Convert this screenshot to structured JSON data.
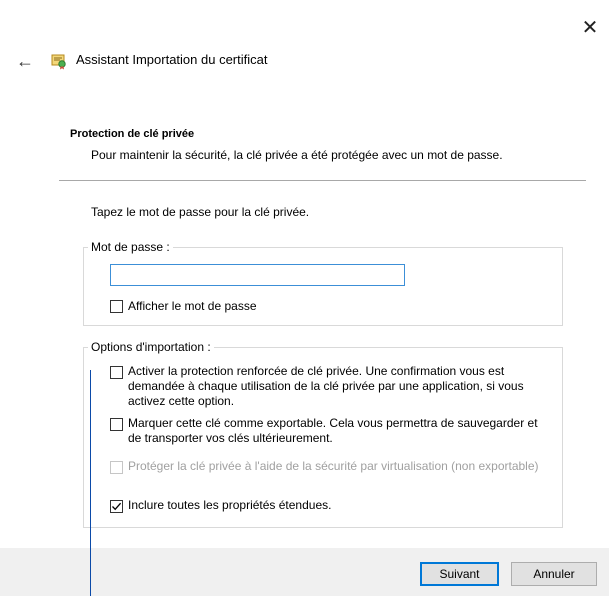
{
  "window": {
    "title": "Assistant Importation du certificat",
    "close_glyph": "✕",
    "back_glyph": "←",
    "icon": "certificate-icon"
  },
  "section": {
    "title": "Protection de clé privée",
    "subtitle": "Pour maintenir la sécurité, la clé privée a été protégée avec un mot de passe."
  },
  "prompt": "Tapez le mot de passe pour la clé privée.",
  "password_group": {
    "legend": "Mot de passe :",
    "value": "",
    "placeholder": "",
    "show_password": {
      "label": "Afficher le mot de passe",
      "checked": false
    }
  },
  "options_group": {
    "legend": "Options d'importation :",
    "options": [
      {
        "line1": "Activer la protection renforcée de clé privée. Une confirmation vous est",
        "line2": "demandée à chaque utilisation de la clé privée par une application, si vous",
        "line3": "activez cette option.",
        "checked": false,
        "disabled": false
      },
      {
        "line1": "Marquer cette clé comme exportable. Cela vous permettra de sauvegarder et",
        "line2": "de transporter vos clés ultérieurement.",
        "checked": false,
        "disabled": false
      },
      {
        "line1": "Protéger la clé privée à l'aide de la sécurité par virtualisation (non exportable)",
        "checked": false,
        "disabled": true
      },
      {
        "line1": "Inclure toutes les propriétés étendues.",
        "checked": true,
        "disabled": false
      }
    ]
  },
  "footer": {
    "next_label": "Suivant",
    "cancel_label": "Annuler"
  },
  "colors": {
    "accent": "#0078d7",
    "footer_bg": "#f0f0f0",
    "disabled_text": "#a0a0a0"
  }
}
